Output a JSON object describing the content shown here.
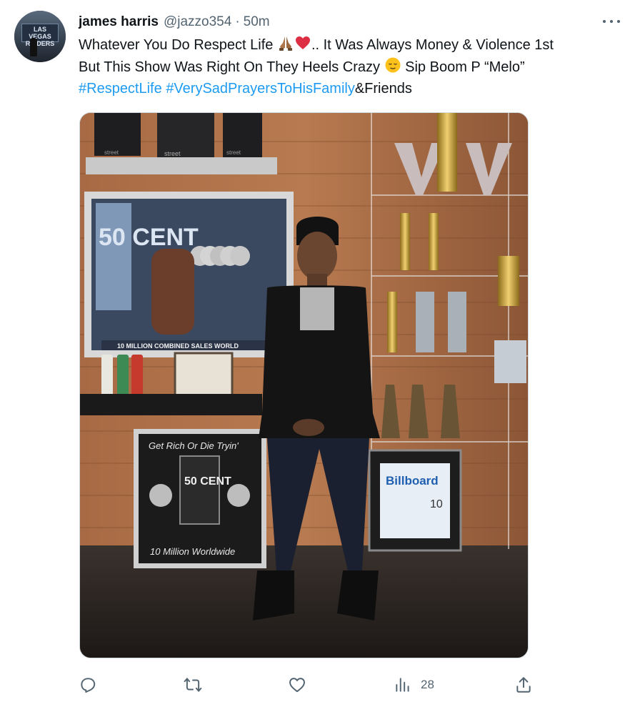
{
  "tweet": {
    "author_name": "james harris",
    "author_handle": "@jazzo354",
    "separator": "·",
    "timestamp": "50m",
    "avatar_text": "LAS VEGAS RAIDERS",
    "text_line1_a": "Whatever You Do Respect Life",
    "text_line1_b": ".. It Was Always Money & Violence 1st",
    "text_line2_a": "But This Show Was Right On They Heels Crazy",
    "text_line2_b": "Sip Boom P “Melo”",
    "hashtag1": "#RespectLife",
    "hashtag2": "#VerySadPrayersToHisFamily",
    "text_line3_tail": "&Friends",
    "emojis": [
      "praying-hands-emoji",
      "red-heart-emoji",
      "relieved-face-emoji"
    ]
  },
  "media": {
    "plaque_top_text": "10 MILLION COMBINED SALES WORLD",
    "plaque_big_text": "50 CENT",
    "plaque2_title": "Get Rich Or Die Tryin'",
    "plaque2_logo": "50 CENT",
    "plaque2_footer": "10 Million Worldwide",
    "billboard_text": "Billboard",
    "billboard_year": "10",
    "shelf_text_1": "street",
    "shelf_text_2": "street",
    "shelf_text_3": "street"
  },
  "actions": {
    "reply_count": "",
    "retweet_count": "",
    "like_count": "",
    "views_count": "28"
  },
  "colors": {
    "link": "#1d9bf0",
    "secondary_text": "#536471",
    "primary_text": "#0f1419"
  }
}
